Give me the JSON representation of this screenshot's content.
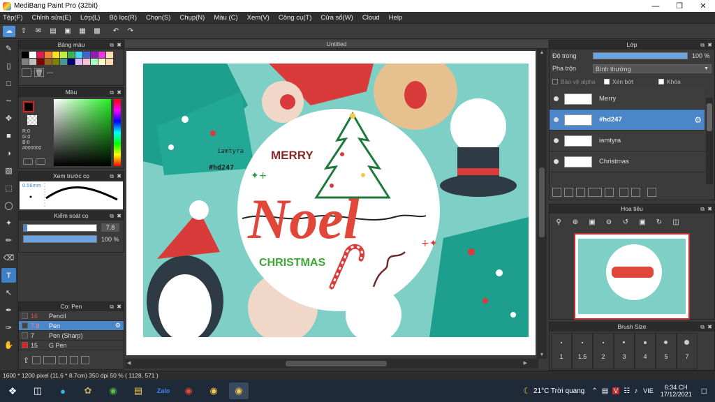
{
  "window": {
    "title": "MediBang Paint Pro (32bit)"
  },
  "menu": [
    "Tệp(F)",
    "Chỉnh sửa(E)",
    "Lớp(L)",
    "Bộ lọc(R)",
    "Chọn(S)",
    "Chụp(N)",
    "Màu (C)",
    "Xem(V)",
    "Công cụ(T)",
    "Cửa sổ(W)",
    "Cloud",
    "Help"
  ],
  "palette": {
    "title": "Bảng màu",
    "set_name": "---"
  },
  "color_panel": {
    "title": "Màu",
    "r": "R:0",
    "g": "G:0",
    "b": "B:0",
    "hex": "#000000"
  },
  "brush_preview": {
    "title": "Xem trước cọ",
    "size": "0.56mm"
  },
  "brush_control": {
    "title": "Kiểm soát cọ",
    "size_value": "7.8",
    "opacity_value": "100 %",
    "size_fill": 0.05,
    "opacity_fill": 1.0
  },
  "brushes": {
    "title": "Cọ: Pen",
    "items": [
      {
        "size": "16",
        "name": "Pencil",
        "color": "#444444"
      },
      {
        "size": "7.8",
        "name": "Pen",
        "color": "#444444",
        "selected": true
      },
      {
        "size": "7",
        "name": "Pen (Sharp)",
        "color": "#444444"
      },
      {
        "size": "15",
        "name": "G Pen",
        "color": "#e02020"
      }
    ]
  },
  "canvas": {
    "tab": "Untitled",
    "artwork": {
      "merry": "MERRY",
      "noel": "Noel",
      "christmas": "CHRISTMAS",
      "signature": "iamtyra",
      "hashtag": "#hd247"
    }
  },
  "status": "1600 * 1200 pixel   (11.6 * 8.7cm)  350 dpi  50 %  ( 1128, 571 )",
  "layers": {
    "title": "Lớp",
    "opacity_label": "Độ trong",
    "opacity_value": "100 %",
    "blend_label": "Pha trộn",
    "blend_value": "Bình thường",
    "protect_alpha": "Bảo vệ alpha",
    "clipping": "Xén bớt",
    "lock": "Khóa",
    "items": [
      {
        "name": "Merry",
        "selected": false
      },
      {
        "name": "#hd247",
        "selected": true
      },
      {
        "name": "iamtyra",
        "selected": false
      },
      {
        "name": "Christmas",
        "selected": false
      }
    ]
  },
  "navigator": {
    "title": "Hoa tiêu"
  },
  "brush_size": {
    "title": "Brush Size",
    "sizes": [
      "1",
      "1.5",
      "2",
      "3",
      "4",
      "5",
      "7"
    ]
  },
  "taskbar": {
    "weather": "21°C  Trời quang",
    "lang": "VIE",
    "time": "6:34 CH",
    "date": "17/12/2021"
  }
}
